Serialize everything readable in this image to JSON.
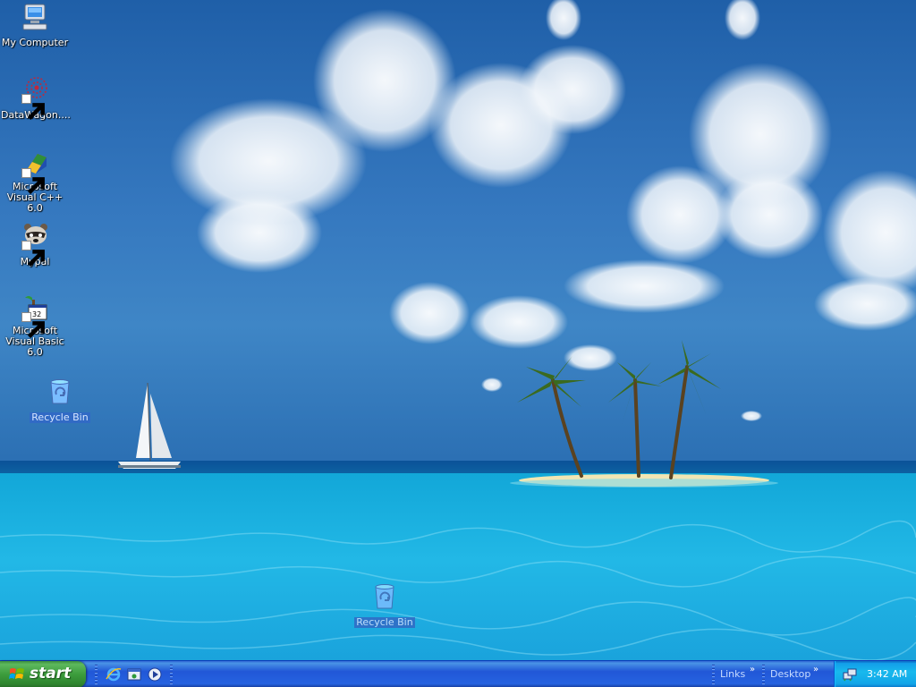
{
  "desktop": {
    "icons": [
      {
        "label": "My Computer",
        "icon": "my-computer-icon"
      },
      {
        "label": "DataWagon....",
        "icon": "datawagon-icon"
      },
      {
        "label": "Microsoft Visual C++ 6.0",
        "icon": "visual-cpp-icon"
      },
      {
        "label": "Mypal",
        "icon": "mypal-raccoon-icon"
      },
      {
        "label": "Microsoft Visual Basic 6.0",
        "icon": "visual-basic-icon"
      },
      {
        "label": "Recycle Bin",
        "icon": "recycle-bin-icon"
      }
    ],
    "dragged_icon": {
      "label": "Recycle Bin",
      "icon": "recycle-bin-icon"
    }
  },
  "taskbar": {
    "start_label": "start",
    "quick_launch": [
      "internet-explorer-icon",
      "show-desktop-icon",
      "media-player-icon"
    ],
    "toolbars": [
      {
        "label": "Links",
        "chevron": "»"
      },
      {
        "label": "Desktop",
        "chevron": "»"
      }
    ],
    "tray": {
      "icons": [
        "network-icon"
      ],
      "clock": "3:42 AM"
    }
  },
  "colors": {
    "taskbar_blue": "#245edc",
    "start_green": "#3c9c3c",
    "tray_blue": "#12a5e8",
    "selection_blue": "#316ac5"
  }
}
